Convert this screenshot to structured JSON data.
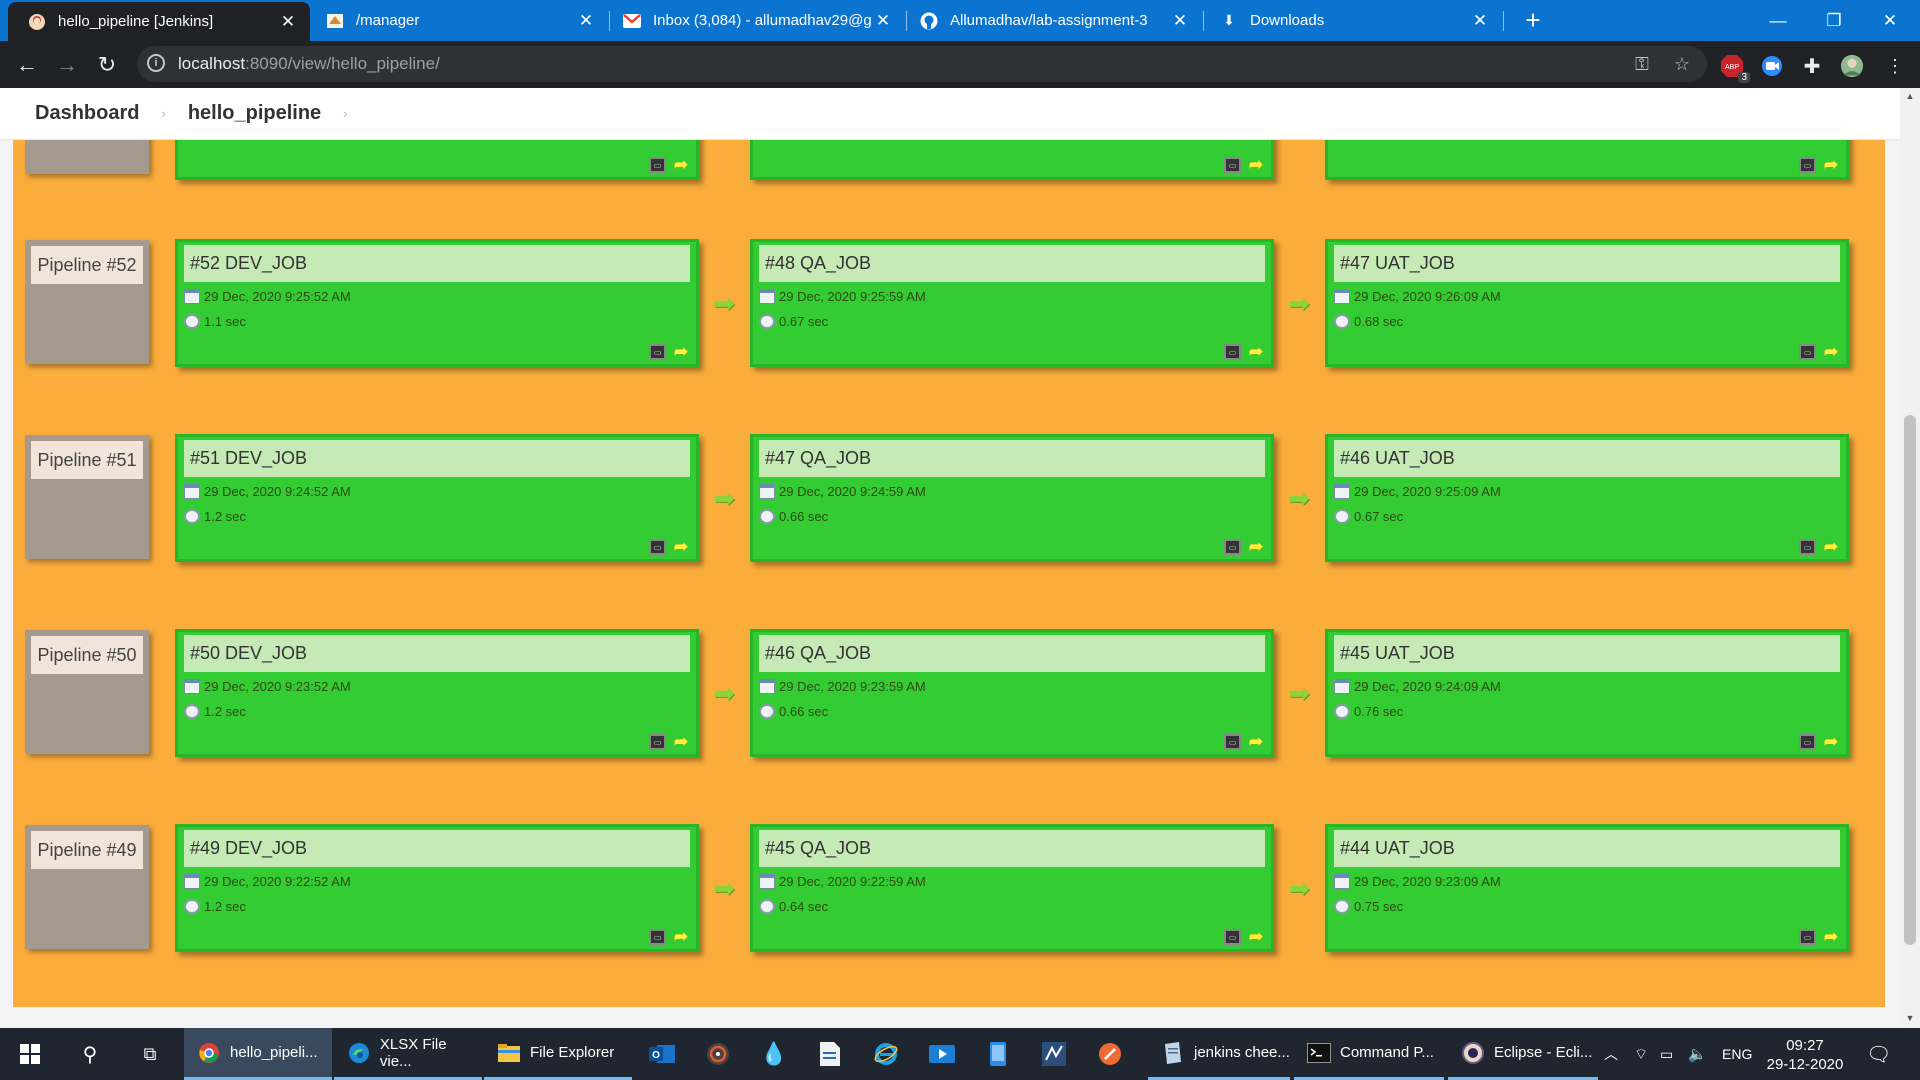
{
  "browser": {
    "tabs": [
      {
        "title": "hello_pipeline [Jenkins]",
        "icon": "jenkins-icon",
        "active": true
      },
      {
        "title": "/manager",
        "icon": "tomcat-icon",
        "active": false
      },
      {
        "title": "Inbox (3,084) - allumadhav29@g",
        "icon": "gmail-icon",
        "active": false
      },
      {
        "title": "Allumadhav/lab-assignment-3",
        "icon": "github-icon",
        "active": false
      },
      {
        "title": "Downloads",
        "icon": "download-icon",
        "active": false
      }
    ],
    "url_host": "localhost",
    "url_rest": ":8090/view/hello_pipeline/",
    "extension_badge": "3"
  },
  "breadcrumb": {
    "items": [
      "Dashboard",
      "hello_pipeline"
    ]
  },
  "pipelines": [
    {
      "label": "Pipeline #52",
      "jobs": [
        {
          "title": "#52 DEV_JOB",
          "date": "29 Dec, 2020 9:25:52 AM",
          "duration": "1.1 sec"
        },
        {
          "title": "#48 QA_JOB",
          "date": "29 Dec, 2020 9:25:59 AM",
          "duration": "0.67 sec"
        },
        {
          "title": "#47 UAT_JOB",
          "date": "29 Dec, 2020 9:26:09 AM",
          "duration": "0.68 sec"
        }
      ]
    },
    {
      "label": "Pipeline #51",
      "jobs": [
        {
          "title": "#51 DEV_JOB",
          "date": "29 Dec, 2020 9:24:52 AM",
          "duration": "1.2 sec"
        },
        {
          "title": "#47 QA_JOB",
          "date": "29 Dec, 2020 9:24:59 AM",
          "duration": "0.66 sec"
        },
        {
          "title": "#46 UAT_JOB",
          "date": "29 Dec, 2020 9:25:09 AM",
          "duration": "0.67 sec"
        }
      ]
    },
    {
      "label": "Pipeline #50",
      "jobs": [
        {
          "title": "#50 DEV_JOB",
          "date": "29 Dec, 2020 9:23:52 AM",
          "duration": "1.2 sec"
        },
        {
          "title": "#46 QA_JOB",
          "date": "29 Dec, 2020 9:23:59 AM",
          "duration": "0.66 sec"
        },
        {
          "title": "#45 UAT_JOB",
          "date": "29 Dec, 2020 9:24:09 AM",
          "duration": "0.76 sec"
        }
      ]
    },
    {
      "label": "Pipeline #49",
      "jobs": [
        {
          "title": "#49 DEV_JOB",
          "date": "29 Dec, 2020 9:22:52 AM",
          "duration": "1.2 sec"
        },
        {
          "title": "#45 QA_JOB",
          "date": "29 Dec, 2020 9:22:59 AM",
          "duration": "0.64 sec"
        },
        {
          "title": "#44 UAT_JOB",
          "date": "29 Dec, 2020 9:23:09 AM",
          "duration": "0.75 sec"
        }
      ]
    }
  ],
  "colors": {
    "pipeline_background": "#fbad3c",
    "job_success": "#33cc33",
    "job_title_bg": "#c5eab5",
    "pipeline_label_bg": "#a59a8d"
  },
  "taskbar": {
    "items": [
      {
        "label": "hello_pipeli...",
        "icon": "chrome-icon"
      },
      {
        "label": "XLSX File vie...",
        "icon": "edge-icon"
      },
      {
        "label": "File Explorer",
        "icon": "folder-icon"
      },
      {
        "label": "jenkins chee...",
        "icon": "notepad-icon"
      },
      {
        "label": "Command P...",
        "icon": "cmd-icon"
      },
      {
        "label": "Eclipse - Ecli...",
        "icon": "eclipse-icon"
      }
    ],
    "language": "ENG",
    "time": "09:27",
    "date": "29-12-2020"
  }
}
